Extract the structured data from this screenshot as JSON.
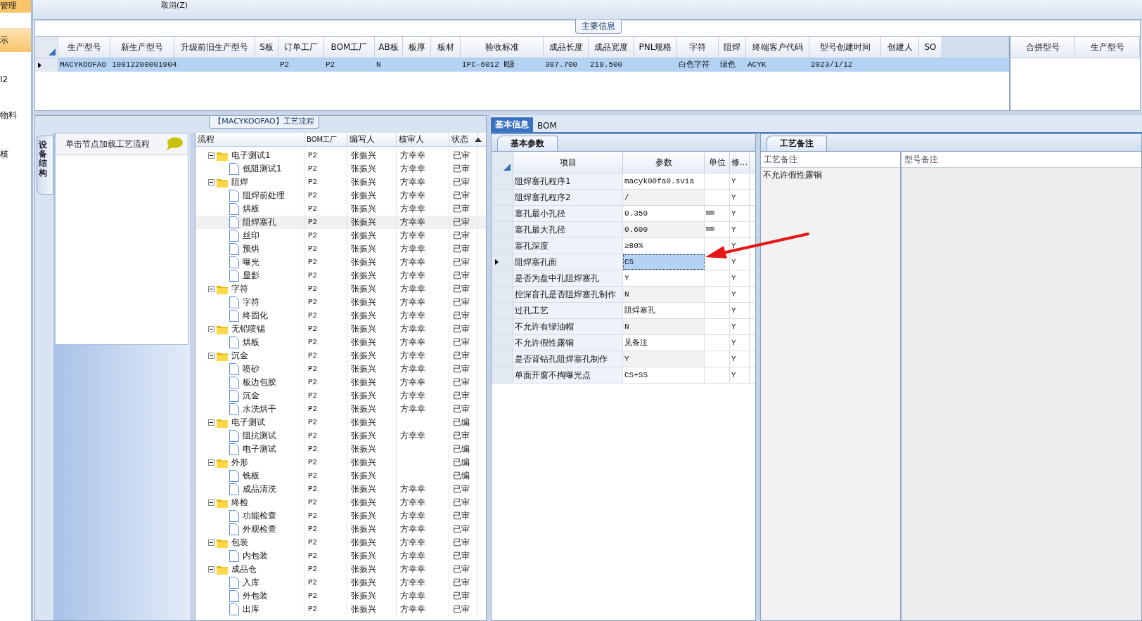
{
  "side_menu": [
    {
      "label": "管理",
      "selected": false
    },
    {
      "label": "示",
      "selected": true
    },
    {
      "label": "I2",
      "selected": false
    },
    {
      "label": "物料",
      "selected": false
    },
    {
      "label": "核",
      "selected": false
    }
  ],
  "toolbar": {
    "cancel": "取消(Z)"
  },
  "main_info": {
    "title": "主要信息",
    "columns": [
      "生产型号",
      "新生产型号",
      "升级前旧生产型号",
      "S板",
      "订单工厂",
      "BOM工厂",
      "AB板",
      "板厚",
      "板材",
      "验收标准",
      "成品长度",
      "成品宽度",
      "PNL规格",
      "字符",
      "阻焊",
      "终端客户代码",
      "型号创建时间",
      "创建人",
      "SO"
    ],
    "rows": [
      {
        "selected": true,
        "cells": [
          "MACYKOOFAO",
          "10012200001904",
          "",
          "",
          "P2",
          "P2",
          "N",
          "",
          "",
          "IPC-6012 Ⅱ级",
          "387.700",
          "219.500",
          "",
          "白色字符",
          "绿色",
          "ACYK",
          "2023/1/12",
          "",
          ""
        ]
      }
    ],
    "side_columns": [
      "合拼型号",
      "生产型号"
    ]
  },
  "flow": {
    "title": "【MACYKOOFAO】工艺流程",
    "vertical_tab": "设备结构",
    "hint": "单击节点加载工艺流程",
    "columns": [
      "流程",
      "BOM工厂",
      "编写人",
      "核审人",
      "状态"
    ],
    "nodes": [
      {
        "name": "电子测试1",
        "bom": "P2",
        "writer": "张振兴",
        "reviewer": "方幸幸",
        "status": "已审",
        "selected": false,
        "expanded": true,
        "children": [
          {
            "name": "低阻测试1",
            "bom": "P2",
            "writer": "张振兴",
            "reviewer": "方幸幸",
            "status": "已审",
            "selected": false
          }
        ]
      },
      {
        "name": "阻焊",
        "bom": "P2",
        "writer": "张振兴",
        "reviewer": "方幸幸",
        "status": "已审",
        "selected": false,
        "expanded": true,
        "children": [
          {
            "name": "阻焊前处理",
            "bom": "P2",
            "writer": "张振兴",
            "reviewer": "方幸幸",
            "status": "已审",
            "selected": false
          },
          {
            "name": "烘板",
            "bom": "P2",
            "writer": "张振兴",
            "reviewer": "方幸幸",
            "status": "已审",
            "selected": false
          },
          {
            "name": "阻焊塞孔",
            "bom": "P2",
            "writer": "张振兴",
            "reviewer": "方幸幸",
            "status": "已审",
            "selected": true
          },
          {
            "name": "丝印",
            "bom": "P2",
            "writer": "张振兴",
            "reviewer": "方幸幸",
            "status": "已审",
            "selected": false
          },
          {
            "name": "预烘",
            "bom": "P2",
            "writer": "张振兴",
            "reviewer": "方幸幸",
            "status": "已审",
            "selected": false
          },
          {
            "name": "曝光",
            "bom": "P2",
            "writer": "张振兴",
            "reviewer": "方幸幸",
            "status": "已审",
            "selected": false
          },
          {
            "name": "显影",
            "bom": "P2",
            "writer": "张振兴",
            "reviewer": "方幸幸",
            "status": "已审",
            "selected": false
          }
        ]
      },
      {
        "name": "字符",
        "bom": "P2",
        "writer": "张振兴",
        "reviewer": "方幸幸",
        "status": "已审",
        "selected": false,
        "expanded": true,
        "children": [
          {
            "name": "字符",
            "bom": "P2",
            "writer": "张振兴",
            "reviewer": "方幸幸",
            "status": "已审",
            "selected": false
          },
          {
            "name": "终固化",
            "bom": "P2",
            "writer": "张振兴",
            "reviewer": "方幸幸",
            "status": "已审",
            "selected": false
          }
        ]
      },
      {
        "name": "无铅喷锡",
        "bom": "P2",
        "writer": "张振兴",
        "reviewer": "方幸幸",
        "status": "已审",
        "selected": false,
        "expanded": true,
        "children": [
          {
            "name": "烘板",
            "bom": "P2",
            "writer": "张振兴",
            "reviewer": "方幸幸",
            "status": "已审",
            "selected": false
          }
        ]
      },
      {
        "name": "沉金",
        "bom": "P2",
        "writer": "张振兴",
        "reviewer": "方幸幸",
        "status": "已审",
        "selected": false,
        "expanded": true,
        "children": [
          {
            "name": "喷砂",
            "bom": "P2",
            "writer": "张振兴",
            "reviewer": "方幸幸",
            "status": "已审",
            "selected": false
          },
          {
            "name": "板边包胶",
            "bom": "P2",
            "writer": "张振兴",
            "reviewer": "方幸幸",
            "status": "已审",
            "selected": false
          },
          {
            "name": "沉金",
            "bom": "P2",
            "writer": "张振兴",
            "reviewer": "方幸幸",
            "status": "已审",
            "selected": false
          },
          {
            "name": "水洗烘干",
            "bom": "P2",
            "writer": "张振兴",
            "reviewer": "方幸幸",
            "status": "已审",
            "selected": false
          }
        ]
      },
      {
        "name": "电子测试",
        "bom": "P2",
        "writer": "张振兴",
        "status": "已编",
        "selected": false,
        "expanded": true,
        "children": [
          {
            "name": "阻抗测试",
            "bom": "P2",
            "writer": "张振兴",
            "reviewer": "方幸幸",
            "status": "已审",
            "selected": false
          },
          {
            "name": "电子测试",
            "bom": "P2",
            "writer": "张振兴",
            "status": "已编",
            "selected": false
          }
        ]
      },
      {
        "name": "外形",
        "bom": "P2",
        "writer": "张振兴",
        "status": "已编",
        "selected": false,
        "expanded": true,
        "children": [
          {
            "name": "铣板",
            "bom": "P2",
            "writer": "张振兴",
            "status": "已编",
            "selected": false
          },
          {
            "name": "成品清洗",
            "bom": "P2",
            "writer": "张振兴",
            "reviewer": "方幸幸",
            "status": "已审",
            "selected": false
          }
        ]
      },
      {
        "name": "终检",
        "bom": "P2",
        "writer": "张振兴",
        "reviewer": "方幸幸",
        "status": "已审",
        "selected": false,
        "expanded": true,
        "children": [
          {
            "name": "功能检查",
            "bom": "P2",
            "writer": "张振兴",
            "reviewer": "方幸幸",
            "status": "已审",
            "selected": false
          },
          {
            "name": "外观检查",
            "bom": "P2",
            "writer": "张振兴",
            "reviewer": "方幸幸",
            "status": "已审",
            "selected": false
          }
        ]
      },
      {
        "name": "包装",
        "bom": "P2",
        "writer": "张振兴",
        "reviewer": "方幸幸",
        "status": "已审",
        "selected": false,
        "expanded": true,
        "children": [
          {
            "name": "内包装",
            "bom": "P2",
            "writer": "张振兴",
            "reviewer": "方幸幸",
            "status": "已审",
            "selected": false
          }
        ]
      },
      {
        "name": "成品仓",
        "bom": "P2",
        "writer": "张振兴",
        "reviewer": "方幸幸",
        "status": "已审",
        "selected": false,
        "expanded": true,
        "children": [
          {
            "name": "入库",
            "bom": "P2",
            "writer": "张振兴",
            "reviewer": "方幸幸",
            "status": "已审",
            "selected": false
          },
          {
            "name": "外包装",
            "bom": "P2",
            "writer": "张振兴",
            "reviewer": "方幸幸",
            "status": "已审",
            "selected": false
          },
          {
            "name": "出库",
            "bom": "P2",
            "writer": "张振兴",
            "reviewer": "方幸幸",
            "status": "已审",
            "selected": false
          }
        ]
      }
    ]
  },
  "tabs": [
    {
      "label": "基本信息",
      "selected": true
    },
    {
      "label": "BOM",
      "selected": false
    }
  ],
  "params": {
    "title": "基本参数",
    "columns": [
      "项目",
      "参数",
      "单位",
      "修..."
    ],
    "rows": [
      {
        "item": "阻焊塞孔程序1",
        "value": "macyk00fa0.svia",
        "flag": "Y",
        "selected": false
      },
      {
        "item": "阻焊塞孔程序2",
        "value": "/",
        "flag": "Y",
        "selected": false
      },
      {
        "item": "塞孔最小孔径",
        "value": "0.350",
        "unit": "mm",
        "flag": "Y",
        "selected": false
      },
      {
        "item": "塞孔最大孔径",
        "value": "0.600",
        "unit": "mm",
        "flag": "Y",
        "selected": false
      },
      {
        "item": "塞孔深度",
        "value": "≥80%",
        "flag": "Y",
        "selected": false
      },
      {
        "item": "阻焊塞孔面",
        "value": "CS",
        "flag": "Y",
        "selected": true
      },
      {
        "item": "是否为盘中孔阻焊塞孔",
        "value": "Y",
        "flag": "Y",
        "selected": false
      },
      {
        "item": "控深盲孔是否阻焊塞孔制作",
        "value": "N",
        "flag": "Y",
        "selected": false
      },
      {
        "item": "过孔工艺",
        "value": "阻焊塞孔",
        "flag": "Y",
        "selected": false
      },
      {
        "item": "不允许有绿油帽",
        "value": "N",
        "flag": "Y",
        "selected": false
      },
      {
        "item": "不允许假性露铜",
        "value": "见备注",
        "flag": "Y",
        "selected": false
      },
      {
        "item": "是否背钻孔阻焊塞孔制作",
        "value": "Y",
        "flag": "Y",
        "selected": false
      },
      {
        "item": "单面开窗不掏曝光点",
        "value": "CS+SS",
        "flag": "Y",
        "selected": false
      }
    ]
  },
  "notes": {
    "title": "工艺备注",
    "columns": [
      "工艺备注",
      "型号备注"
    ],
    "text": "不允许假性露铜"
  }
}
